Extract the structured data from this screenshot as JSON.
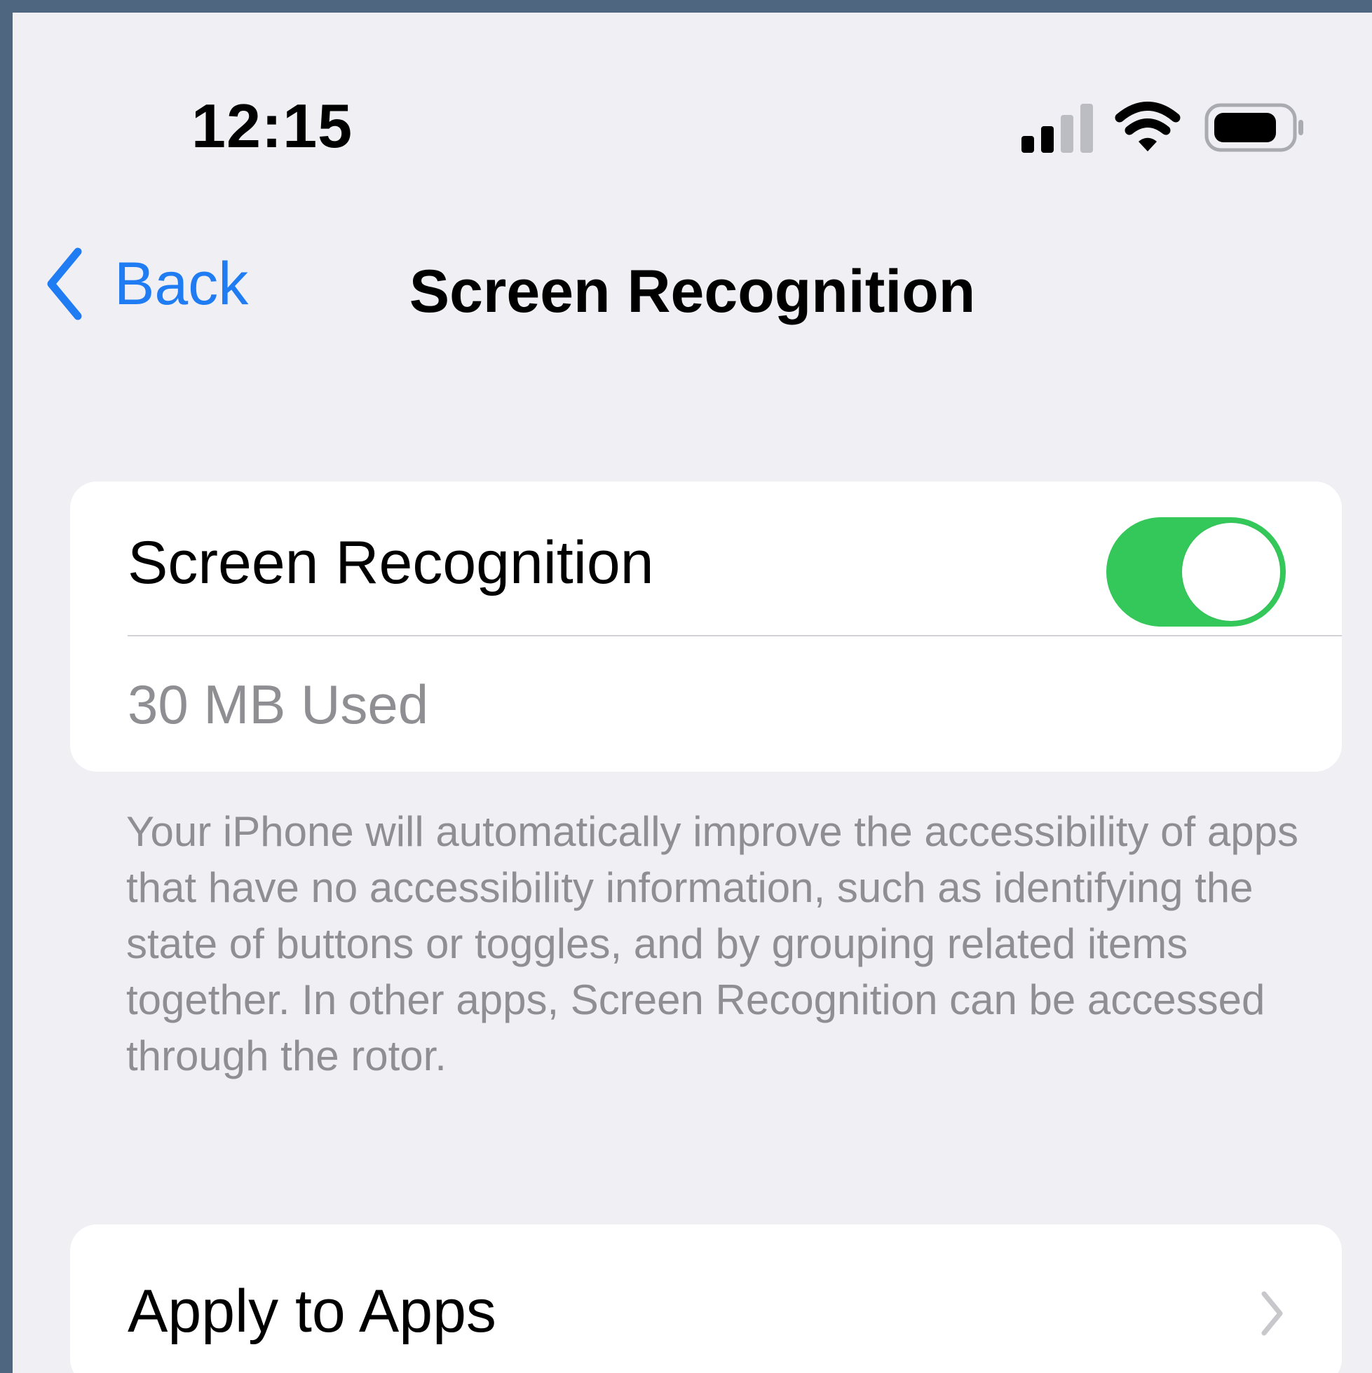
{
  "status_bar": {
    "time": "12:15",
    "icons": [
      "signal-icon",
      "wifi-icon",
      "battery-icon"
    ],
    "signal_strength": 2,
    "signal_max": 4,
    "battery_level_fraction": 0.85
  },
  "nav": {
    "back_label": "Back",
    "title": "Screen Recognition"
  },
  "settings": {
    "toggle_label": "Screen Recognition",
    "toggle_on": true,
    "usage": "30 MB Used",
    "description": "Your iPhone will automatically improve the accessibility of apps that have no accessibility information, such as identifying the state of buttons or toggles, and by grouping related items together. In other apps, Screen Recognition can be accessed through the rotor.",
    "apply_label": "Apply to Apps"
  },
  "colors": {
    "accent": "#1f7cf3",
    "toggle_on": "#34c759",
    "background": "#efeff4",
    "secondary_text": "#8e8e93"
  }
}
